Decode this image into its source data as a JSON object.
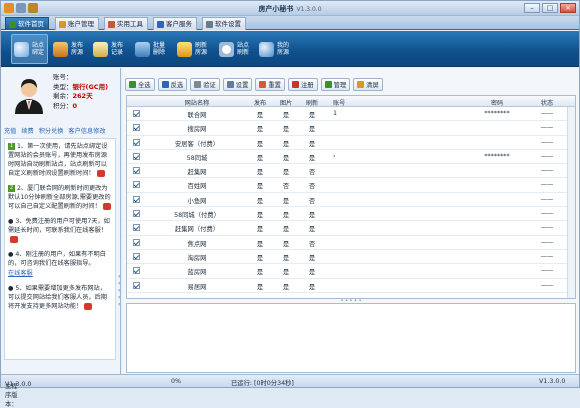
{
  "window": {
    "title": "房产小秘书",
    "version": "V1.3.0.0"
  },
  "tabs": [
    {
      "label": "软件首页",
      "color": "#3d8f2a"
    },
    {
      "label": "账户管理",
      "color": "#d79a1e"
    },
    {
      "label": "实用工具",
      "color": "#c85a28"
    },
    {
      "label": "客户服务",
      "color": "#2a67b8"
    },
    {
      "label": "软件设置",
      "color": "#6a7a8a"
    }
  ],
  "ribbon": [
    {
      "label": "站点绑定",
      "color": "#c9dff2"
    },
    {
      "label": "发布房源",
      "color": "#e0a43a"
    },
    {
      "label": "发布记录",
      "color": "#e5d27a"
    },
    {
      "label": "批量删除",
      "color": "#6ea9dc"
    },
    {
      "label": "刷新房源",
      "color": "#f0c040"
    },
    {
      "label": "站点刷新",
      "color": "#dfe9f3"
    },
    {
      "label": "我的房源",
      "color": "#7fb0e0"
    }
  ],
  "account": {
    "no_label": "账号：",
    "no_value": "",
    "type_label": "类型：",
    "type_value": "银行(GC用)",
    "remain_label": "剩余：",
    "remain_value": "262天",
    "points_label": "积分：",
    "points_value": "0"
  },
  "quicklinks": [
    "充值",
    "续费",
    "积分兑换",
    "客户信息修改"
  ],
  "tips": [
    {
      "num": "1",
      "text": "1、第一次使用，请先站点绑定设置网站的会员账号，再使用发布房源时网站自动刷新站点，站点刷新可以自定义刷新时间设置刷新时间！"
    },
    {
      "num": "2",
      "text": "2、厦门联合网的刷新时间更改为默认10分钟刷新全部房源,需要更改的可以自己自定义配置刷新的时间！"
    },
    {
      "num": "3",
      "text": "● 3、免费注册的用户可使用7天，如需延长时间，可联系我们在线客服！"
    },
    {
      "num": "4",
      "text": "● 4、刚注册的用户，如果有不明白的，可咨询我们在线客服指导。"
    },
    {
      "num": "",
      "text": "在线客服"
    },
    {
      "num": "5",
      "text": "● 5、如果需要增加更多发布网站，可以提交网站给我们客服人员，后期将开发支持更多网站功能！"
    }
  ],
  "toolbar": [
    "全选",
    "反选",
    "验证",
    "设置",
    "重置",
    "注册",
    "管理",
    "清屏"
  ],
  "grid": {
    "headers": [
      "网站名称",
      "发布",
      "图片",
      "刷新",
      "账号",
      "密码",
      "状态"
    ],
    "rows": [
      {
        "name": "联合网",
        "pub": "是",
        "img": "是",
        "ref": "是",
        "acct": "1",
        "pwd": "********",
        "status": "——"
      },
      {
        "name": "搜房网",
        "pub": "是",
        "img": "是",
        "ref": "是",
        "acct": "",
        "pwd": "",
        "status": "——"
      },
      {
        "name": "安居客（付费）",
        "pub": "是",
        "img": "是",
        "ref": "是",
        "acct": "",
        "pwd": "",
        "status": "——"
      },
      {
        "name": "58同城",
        "pub": "是",
        "img": "是",
        "ref": "是",
        "acct": "›",
        "pwd": "********",
        "status": "——"
      },
      {
        "name": "赶集网",
        "pub": "是",
        "img": "是",
        "ref": "否",
        "acct": "",
        "pwd": "",
        "status": "——"
      },
      {
        "name": "百姓网",
        "pub": "是",
        "img": "否",
        "ref": "否",
        "acct": "",
        "pwd": "",
        "status": "——"
      },
      {
        "name": "小鱼网",
        "pub": "是",
        "img": "是",
        "ref": "否",
        "acct": "",
        "pwd": "",
        "status": "——"
      },
      {
        "name": "58同城（付费）",
        "pub": "是",
        "img": "是",
        "ref": "是",
        "acct": "",
        "pwd": "",
        "status": "——"
      },
      {
        "name": "赶集网（付费）",
        "pub": "是",
        "img": "是",
        "ref": "是",
        "acct": "",
        "pwd": "",
        "status": "——"
      },
      {
        "name": "焦点网",
        "pub": "是",
        "img": "是",
        "ref": "否",
        "acct": "",
        "pwd": "",
        "status": "——"
      },
      {
        "name": "淘房网",
        "pub": "是",
        "img": "是",
        "ref": "是",
        "acct": "",
        "pwd": "",
        "status": "——"
      },
      {
        "name": "蓝房网",
        "pub": "是",
        "img": "是",
        "ref": "是",
        "acct": "",
        "pwd": "",
        "status": "——"
      },
      {
        "name": "易居网",
        "pub": "是",
        "img": "是",
        "ref": "是",
        "acct": "",
        "pwd": "",
        "status": "——"
      }
    ]
  },
  "status": {
    "version_label": "主程序版本：",
    "version": "V1.3.0.0",
    "progress": "0%",
    "elapsed": "已运行: [0时0分34秒]",
    "right_version": "V1.3.0.0"
  }
}
